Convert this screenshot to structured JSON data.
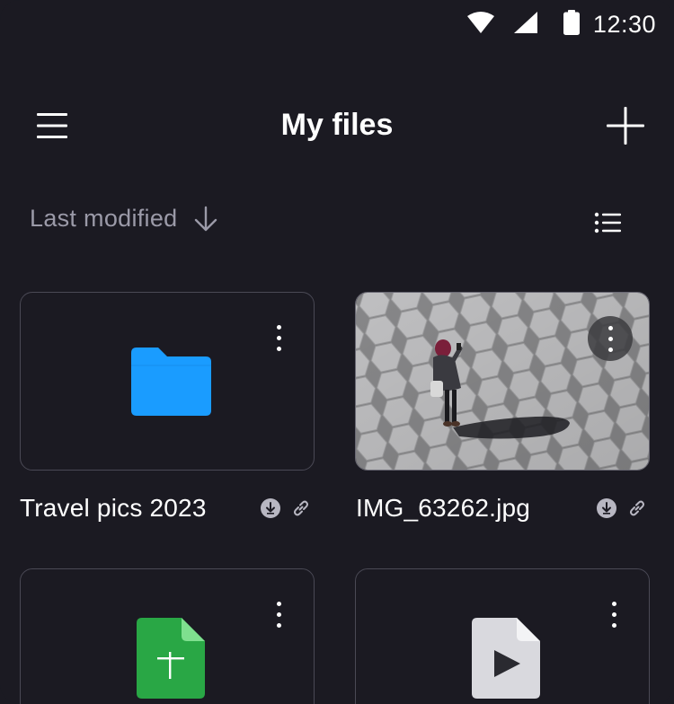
{
  "status_bar": {
    "time": "12:30",
    "icons": [
      "wifi-icon",
      "cellular-signal-icon",
      "battery-icon"
    ]
  },
  "header": {
    "title": "My files",
    "menu_icon": "hamburger-menu-icon",
    "add_icon": "plus-icon"
  },
  "sort": {
    "label": "Last modified",
    "direction_icon": "arrow-down-icon",
    "view_icon": "list-view-icon"
  },
  "files": [
    {
      "name": "Travel pics 2023",
      "type": "folder",
      "icon": "folder-icon",
      "color": "#1a9cff",
      "offline_icon": "download-icon",
      "shared_icon": "link-icon"
    },
    {
      "name": "IMG_63262.jpg",
      "type": "image",
      "icon": "photo-thumbnail",
      "offline_icon": "download-icon",
      "shared_icon": "link-icon"
    },
    {
      "name": "",
      "type": "spreadsheet",
      "icon": "spreadsheet-icon",
      "color": "#29a745"
    },
    {
      "name": "",
      "type": "video",
      "icon": "video-file-icon",
      "color": "#d9d9de"
    }
  ],
  "colors": {
    "background": "#1b1a22",
    "card_border": "#4a4955",
    "muted_text": "#9b9aa8",
    "folder_blue": "#1a9cff",
    "sheet_green": "#29a745"
  }
}
